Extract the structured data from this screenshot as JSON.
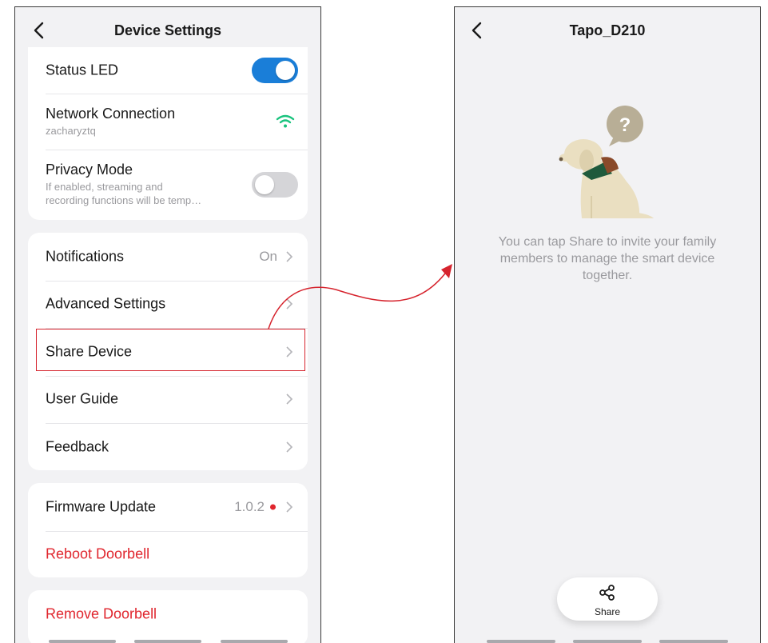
{
  "left": {
    "title": "Device Settings",
    "status_led": {
      "label": "Status LED",
      "state": "on"
    },
    "network": {
      "label": "Network Connection",
      "ssid": "zacharyztq"
    },
    "privacy": {
      "label": "Privacy Mode",
      "desc_line1": "If enabled, streaming and",
      "desc_line2": "recording functions will be temp…",
      "state": "off"
    },
    "menu": {
      "notifications": {
        "label": "Notifications",
        "value": "On"
      },
      "advanced": {
        "label": "Advanced Settings"
      },
      "share": {
        "label": "Share Device"
      },
      "guide": {
        "label": "User Guide"
      },
      "feedback": {
        "label": "Feedback"
      }
    },
    "firmware": {
      "label": "Firmware Update",
      "version": "1.0.2"
    },
    "reboot": {
      "label": "Reboot Doorbell"
    },
    "remove": {
      "label": "Remove Doorbell"
    }
  },
  "right": {
    "title": "Tapo_D210",
    "empty_line1": "You can tap Share to invite your family",
    "empty_line2": "members to manage the smart device",
    "empty_line3": "together.",
    "share_label": "Share"
  },
  "colors": {
    "accent": "#1a7ed8",
    "danger": "#e0262e",
    "wifi": "#19c37d",
    "annotation": "#d6242e"
  },
  "icons": [
    "back-arrow-icon",
    "wifi-icon",
    "chevron-right-icon",
    "share-icon",
    "dog-illustration",
    "question-bubble-icon"
  ]
}
